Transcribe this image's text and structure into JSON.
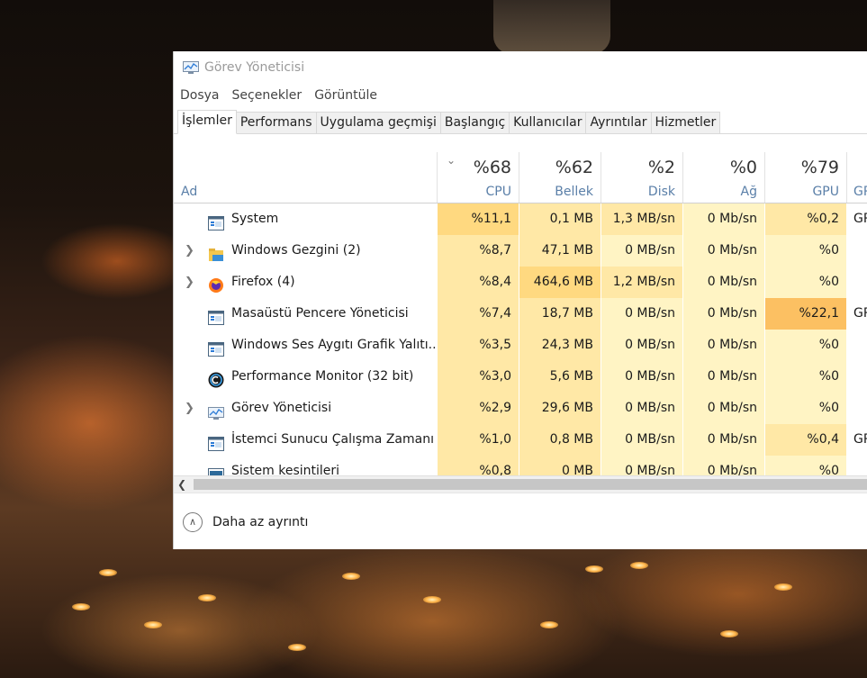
{
  "window": {
    "title": "Görev Yöneticisi"
  },
  "menu": [
    "Dosya",
    "Seçenekler",
    "Görüntüle"
  ],
  "tabs": [
    "İşlemler",
    "Performans",
    "Uygulama geçmişi",
    "Başlangıç",
    "Kullanıcılar",
    "Ayrıntılar",
    "Hizmetler"
  ],
  "active_tab": "İşlemler",
  "columns": {
    "name": {
      "label": "Ad"
    },
    "cpu": {
      "total": "%68",
      "label": "CPU"
    },
    "memory": {
      "total": "%62",
      "label": "Bellek"
    },
    "disk": {
      "total": "%2",
      "label": "Disk"
    },
    "network": {
      "total": "%0",
      "label": "Ağ"
    },
    "gpu": {
      "total": "%79",
      "label": "GPU"
    },
    "gpu_engine": {
      "label": "GP"
    }
  },
  "processes": [
    {
      "name": "System",
      "icon": "system-window-icon",
      "expandable": false,
      "cpu": "%11,1",
      "memory": "0,1 MB",
      "disk": "1,3 MB/sn",
      "network": "0 Mb/sn",
      "gpu": "%0,2",
      "gpu_engine": "GP"
    },
    {
      "name": "Windows Gezgini (2)",
      "icon": "folder-icon",
      "expandable": true,
      "cpu": "%8,7",
      "memory": "47,1 MB",
      "disk": "0 MB/sn",
      "network": "0 Mb/sn",
      "gpu": "%0",
      "gpu_engine": ""
    },
    {
      "name": "Firefox (4)",
      "icon": "firefox-icon",
      "expandable": true,
      "cpu": "%8,4",
      "memory": "464,6 MB",
      "disk": "1,2 MB/sn",
      "network": "0 Mb/sn",
      "gpu": "%0",
      "gpu_engine": ""
    },
    {
      "name": "Masaüstü Pencere Yöneticisi",
      "icon": "system-window-icon",
      "expandable": false,
      "cpu": "%7,4",
      "memory": "18,7 MB",
      "disk": "0 MB/sn",
      "network": "0 Mb/sn",
      "gpu": "%22,1",
      "gpu_engine": "GP"
    },
    {
      "name": "Windows Ses Aygıtı Grafik Yalıtı...",
      "icon": "system-window-icon",
      "expandable": false,
      "cpu": "%3,5",
      "memory": "24,3 MB",
      "disk": "0 MB/sn",
      "network": "0 Mb/sn",
      "gpu": "%0",
      "gpu_engine": ""
    },
    {
      "name": "Performance Monitor (32 bit)",
      "icon": "performance-monitor-icon",
      "expandable": false,
      "cpu": "%3,0",
      "memory": "5,6 MB",
      "disk": "0 MB/sn",
      "network": "0 Mb/sn",
      "gpu": "%0",
      "gpu_engine": ""
    },
    {
      "name": "Görev Yöneticisi",
      "icon": "task-manager-icon",
      "expandable": true,
      "cpu": "%2,9",
      "memory": "29,6 MB",
      "disk": "0 MB/sn",
      "network": "0 Mb/sn",
      "gpu": "%0",
      "gpu_engine": ""
    },
    {
      "name": "İstemci Sunucu Çalışma Zamanı ...",
      "icon": "system-window-icon",
      "expandable": false,
      "cpu": "%1,0",
      "memory": "0,8 MB",
      "disk": "0 MB/sn",
      "network": "0 Mb/sn",
      "gpu": "%0,4",
      "gpu_engine": "GP"
    },
    {
      "name": "Sistem kesintileri",
      "icon": "system-interrupts-icon",
      "expandable": false,
      "cpu": "%0,8",
      "memory": "0 MB",
      "disk": "0 MB/sn",
      "network": "0 Mb/sn",
      "gpu": "%0",
      "gpu_engine": ""
    }
  ],
  "footer": {
    "label": "Daha az ayrıntı"
  },
  "colors": {
    "heat_light": "#fff4c4",
    "heat_mid": "#ffe8a6",
    "heat_high": "#ffd980",
    "heat_max": "#fcc062",
    "header_label": "#5a7fa8"
  }
}
